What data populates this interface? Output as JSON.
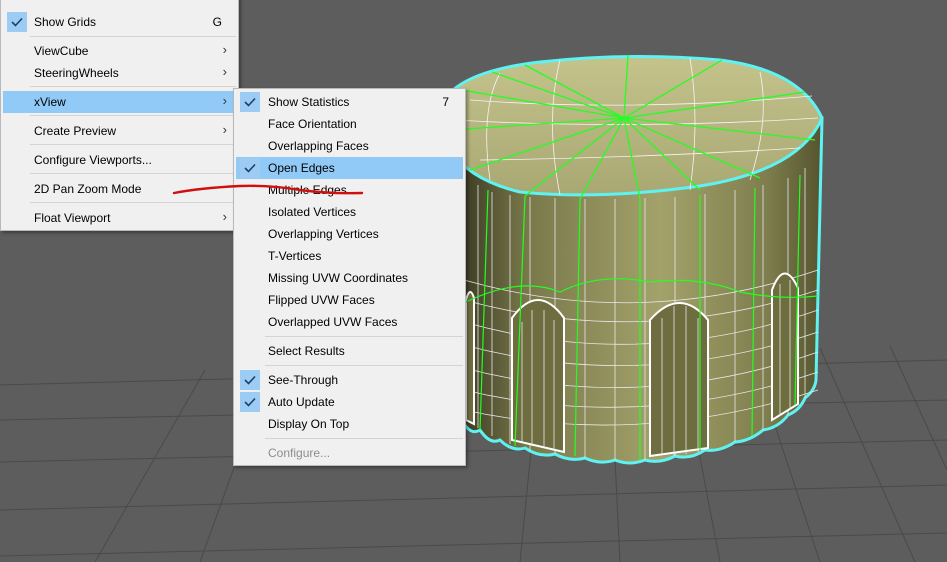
{
  "main_menu": {
    "show_grids": {
      "label": "Show Grids",
      "shortcut": "G",
      "checked": true
    },
    "viewcube": {
      "label": "ViewCube"
    },
    "steeringwheels": {
      "label": "SteeringWheels"
    },
    "xview": {
      "label": "xView"
    },
    "create_preview": {
      "label": "Create Preview"
    },
    "configure_viewports": {
      "label": "Configure Viewports..."
    },
    "pan_zoom_mode": {
      "label": "2D Pan Zoom Mode"
    },
    "float_viewport": {
      "label": "Float Viewport"
    }
  },
  "xview_menu": {
    "show_statistics": {
      "label": "Show Statistics",
      "shortcut": "7",
      "checked": true
    },
    "face_orientation": {
      "label": "Face Orientation"
    },
    "overlapping_faces": {
      "label": "Overlapping Faces"
    },
    "open_edges": {
      "label": "Open Edges",
      "checked": true
    },
    "multiple_edges": {
      "label": "Multiple Edges"
    },
    "isolated_vertices": {
      "label": "Isolated Vertices"
    },
    "overlapping_vertices": {
      "label": "Overlapping Vertices"
    },
    "t_vertices": {
      "label": "T-Vertices"
    },
    "missing_uvw": {
      "label": "Missing UVW Coordinates"
    },
    "flipped_uvw": {
      "label": "Flipped UVW Faces"
    },
    "overlapped_uvw": {
      "label": "Overlapped UVW Faces"
    },
    "select_results": {
      "label": "Select Results"
    },
    "see_through": {
      "label": "See-Through",
      "checked": true
    },
    "auto_update": {
      "label": "Auto Update",
      "checked": true
    },
    "display_on_top": {
      "label": "Display On Top"
    },
    "configure": {
      "label": "Configure...",
      "disabled": true
    }
  },
  "icons": {
    "submenu_arrow": "›",
    "check": "check-icon"
  },
  "colors": {
    "viewport_bg": "#5d5d5d",
    "menu_bg": "#f0f0f0",
    "highlight": "#91c9f7",
    "mesh_fill": "#8f8f55",
    "open_edges_green": "#22ff22",
    "selection_cyan": "#5ef2f2",
    "annotation_red": "#d01010"
  }
}
